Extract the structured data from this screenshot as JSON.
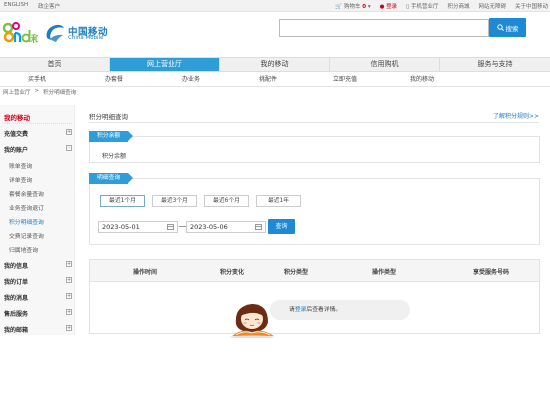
{
  "topbar": {
    "english": "ENGLISH",
    "business": "政企客户",
    "cart": "购物车",
    "cart_count": "0",
    "login": "登录",
    "mobile_hall": "手机营业厅",
    "points_mall": "积分商城",
    "accessibility": "网站无障碍",
    "about": "关于中国移动"
  },
  "header": {
    "logo_and": "and和",
    "brand_cn": "中国移动",
    "brand_en": "China Mobile",
    "search_placeholder": "",
    "search_button": "搜索"
  },
  "nav": {
    "items": [
      {
        "label": "首页",
        "active": false
      },
      {
        "label": "网上营业厅",
        "active": true
      },
      {
        "label": "我的移动",
        "active": false
      },
      {
        "label": "信用购机",
        "active": false
      },
      {
        "label": "服务与支持",
        "active": false
      }
    ],
    "sub": [
      "买手机",
      "办套餐",
      "办业务",
      "挑配件",
      "立即充值",
      "我的移动"
    ]
  },
  "breadcrumb": [
    "网上营业厅",
    ">",
    "积分明细查询"
  ],
  "sidebar": {
    "title": "我的移动",
    "sections": [
      {
        "label": "充值交费",
        "toggle": "+"
      },
      {
        "label": "我的账户",
        "toggle": "-"
      },
      {
        "label": "我的信息",
        "toggle": "+"
      },
      {
        "label": "我的订单",
        "toggle": "+"
      },
      {
        "label": "我的消息",
        "toggle": "+"
      },
      {
        "label": "售后服务",
        "toggle": "+"
      },
      {
        "label": "我的邮箱",
        "toggle": "+"
      }
    ],
    "account_items": [
      "账单查询",
      "详单查询",
      "套餐余量查询",
      "业务查询退订",
      "积分明细查询",
      "交费记录查询",
      "归属地查询"
    ]
  },
  "content": {
    "title": "积分明细查询",
    "rules_link": "了解积分规则>>",
    "balance_tag": "积分余额",
    "balance_label": "积分余额",
    "detail_tag": "明细查询",
    "ranges": [
      "最近1个月",
      "最近3个月",
      "最近6个月",
      "最近1年"
    ],
    "start_date": "2023-05-01",
    "end_date": "2023-05-06",
    "query_button": "查询",
    "columns": [
      "操作时间",
      "积分变化",
      "积分类型",
      "操作类型",
      "享受服务号码"
    ],
    "empty": {
      "before": "请",
      "login": "登录",
      "after": "后查看详情。"
    }
  },
  "colors": {
    "accent": "#2f9ed8",
    "brand": "#1a7cc1",
    "red": "#d0021b"
  }
}
